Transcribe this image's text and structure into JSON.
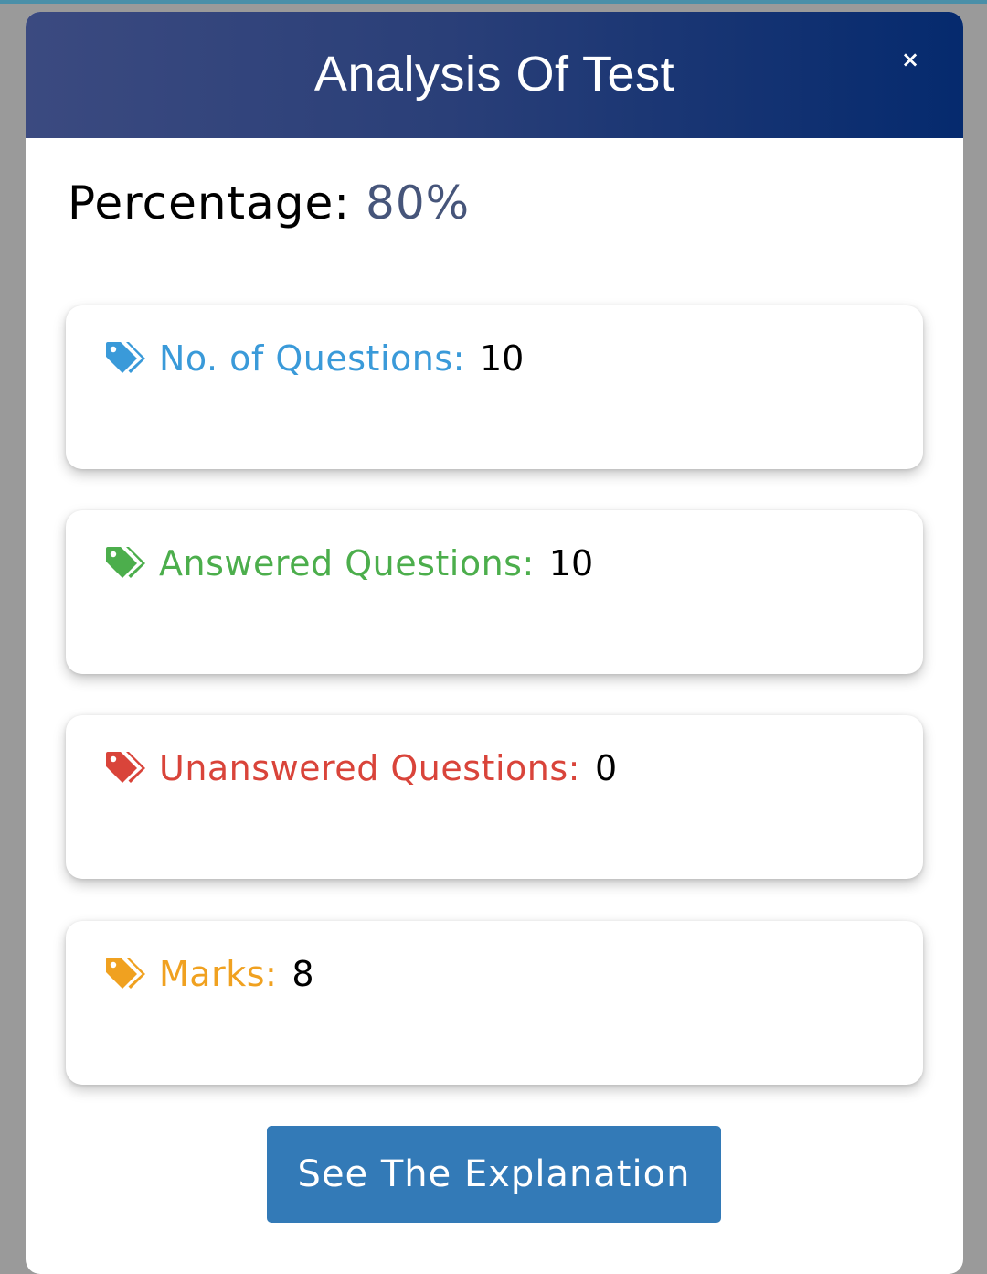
{
  "modal": {
    "title": "Analysis Of Test",
    "close_label": "×"
  },
  "percentage": {
    "label": "Percentage:",
    "value": "80%",
    "value_color": "#46557a"
  },
  "stats": [
    {
      "label": "No. of Questions:",
      "value": "10",
      "color": "#3a9ad9",
      "icon": "tag-icon"
    },
    {
      "label": "Answered Questions:",
      "value": "10",
      "color": "#4cae4c",
      "icon": "tag-icon"
    },
    {
      "label": "Unanswered Questions:",
      "value": "0",
      "color": "#d9443a",
      "icon": "tag-icon"
    },
    {
      "label": "Marks:",
      "value": "8",
      "color": "#f0a120",
      "icon": "tag-icon"
    }
  ],
  "actions": {
    "explanation_label": "See The Explanation",
    "button_color": "#337ab7"
  }
}
